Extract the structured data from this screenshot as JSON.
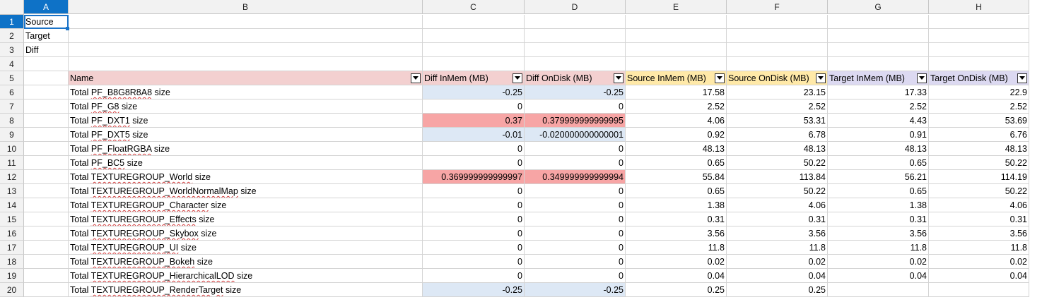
{
  "columns": [
    "A",
    "B",
    "C",
    "D",
    "E",
    "F",
    "G",
    "H"
  ],
  "selected_column": "A",
  "selected_row": "1",
  "row_numbers": [
    "1",
    "2",
    "3",
    "4",
    "5",
    "6",
    "7",
    "8",
    "9",
    "10",
    "11",
    "12",
    "13",
    "14",
    "15",
    "16",
    "17",
    "18",
    "19",
    "20"
  ],
  "legend": [
    "Source",
    "Target",
    "Diff"
  ],
  "headers": {
    "name": "Name",
    "diff_inmem": "Diff InMem (MB)",
    "diff_ondisk": "Diff OnDisk (MB)",
    "source_inmem": "Source InMem (MB)",
    "source_ondisk": "Source OnDisk (MB)",
    "target_inmem": "Target InMem (MB)",
    "target_ondisk": "Target OnDisk (MB)"
  },
  "colors": {
    "name_header": "#f3d0d0",
    "diff_header": "#f3d0d0",
    "source_header": "#ffe9a8",
    "target_header": "#dcd9f1",
    "diff_negative": "#dde8f5",
    "diff_positive": "#f7a5a5",
    "selection": "#1a73c8"
  },
  "rows": [
    {
      "name": "Total PF_B8G8R8A8 size",
      "diff_inmem": "-0.25",
      "diff_ondisk": "-0.25",
      "source_inmem": "17.58",
      "source_ondisk": "23.15",
      "target_inmem": "17.33",
      "target_ondisk": "22.9",
      "hl_c": "neg",
      "hl_d": "neg"
    },
    {
      "name": "Total PF_G8 size",
      "diff_inmem": "0",
      "diff_ondisk": "0",
      "source_inmem": "2.52",
      "source_ondisk": "2.52",
      "target_inmem": "2.52",
      "target_ondisk": "2.52",
      "hl_c": "",
      "hl_d": ""
    },
    {
      "name": "Total PF_DXT1 size",
      "diff_inmem": "0.37",
      "diff_ondisk": "0.379999999999995",
      "source_inmem": "4.06",
      "source_ondisk": "53.31",
      "target_inmem": "4.43",
      "target_ondisk": "53.69",
      "hl_c": "pos",
      "hl_d": "pos"
    },
    {
      "name": "Total PF_DXT5 size",
      "diff_inmem": "-0.01",
      "diff_ondisk": "-0.020000000000001",
      "source_inmem": "0.92",
      "source_ondisk": "6.78",
      "target_inmem": "0.91",
      "target_ondisk": "6.76",
      "hl_c": "neg",
      "hl_d": "neg"
    },
    {
      "name": "Total PF_FloatRGBA size",
      "diff_inmem": "0",
      "diff_ondisk": "0",
      "source_inmem": "48.13",
      "source_ondisk": "48.13",
      "target_inmem": "48.13",
      "target_ondisk": "48.13",
      "hl_c": "",
      "hl_d": ""
    },
    {
      "name": "Total PF_BC5 size",
      "diff_inmem": "0",
      "diff_ondisk": "0",
      "source_inmem": "0.65",
      "source_ondisk": "50.22",
      "target_inmem": "0.65",
      "target_ondisk": "50.22",
      "hl_c": "",
      "hl_d": ""
    },
    {
      "name": "Total TEXTUREGROUP_World size",
      "diff_inmem": "0.369999999999997",
      "diff_ondisk": "0.349999999999994",
      "source_inmem": "55.84",
      "source_ondisk": "113.84",
      "target_inmem": "56.21",
      "target_ondisk": "114.19",
      "hl_c": "pos",
      "hl_d": "pos"
    },
    {
      "name": "Total TEXTUREGROUP_WorldNormalMap size",
      "diff_inmem": "0",
      "diff_ondisk": "0",
      "source_inmem": "0.65",
      "source_ondisk": "50.22",
      "target_inmem": "0.65",
      "target_ondisk": "50.22",
      "hl_c": "",
      "hl_d": ""
    },
    {
      "name": "Total TEXTUREGROUP_Character size",
      "diff_inmem": "0",
      "diff_ondisk": "0",
      "source_inmem": "1.38",
      "source_ondisk": "4.06",
      "target_inmem": "1.38",
      "target_ondisk": "4.06",
      "hl_c": "",
      "hl_d": ""
    },
    {
      "name": "Total TEXTUREGROUP_Effects size",
      "diff_inmem": "0",
      "diff_ondisk": "0",
      "source_inmem": "0.31",
      "source_ondisk": "0.31",
      "target_inmem": "0.31",
      "target_ondisk": "0.31",
      "hl_c": "",
      "hl_d": ""
    },
    {
      "name": "Total TEXTUREGROUP_Skybox size",
      "diff_inmem": "0",
      "diff_ondisk": "0",
      "source_inmem": "3.56",
      "source_ondisk": "3.56",
      "target_inmem": "3.56",
      "target_ondisk": "3.56",
      "hl_c": "",
      "hl_d": ""
    },
    {
      "name": "Total TEXTUREGROUP_UI size",
      "diff_inmem": "0",
      "diff_ondisk": "0",
      "source_inmem": "11.8",
      "source_ondisk": "11.8",
      "target_inmem": "11.8",
      "target_ondisk": "11.8",
      "hl_c": "",
      "hl_d": ""
    },
    {
      "name": "Total TEXTUREGROUP_Bokeh size",
      "diff_inmem": "0",
      "diff_ondisk": "0",
      "source_inmem": "0.02",
      "source_ondisk": "0.02",
      "target_inmem": "0.02",
      "target_ondisk": "0.02",
      "hl_c": "",
      "hl_d": ""
    },
    {
      "name": "Total TEXTUREGROUP_HierarchicalLOD size",
      "diff_inmem": "0",
      "diff_ondisk": "0",
      "source_inmem": "0.04",
      "source_ondisk": "0.04",
      "target_inmem": "0.04",
      "target_ondisk": "0.04",
      "hl_c": "",
      "hl_d": ""
    },
    {
      "name": "Total TEXTUREGROUP_RenderTarget size",
      "diff_inmem": "-0.25",
      "diff_ondisk": "-0.25",
      "source_inmem": "0.25",
      "source_ondisk": "0.25",
      "target_inmem": "",
      "target_ondisk": "",
      "hl_c": "neg",
      "hl_d": "neg"
    }
  ]
}
